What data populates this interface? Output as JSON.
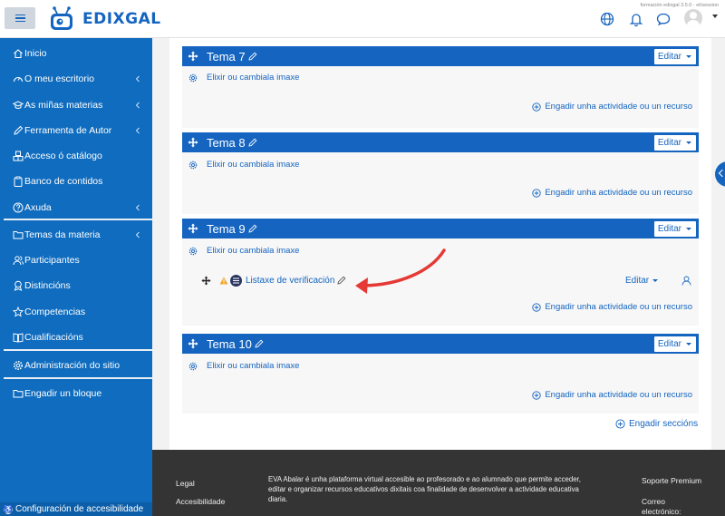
{
  "header": {
    "logo_text": "EDIXGAL",
    "version": "formación edixgal 3.5.0 - et/session",
    "icons": [
      "globe-icon",
      "bell-icon",
      "message-icon",
      "user-avatar"
    ]
  },
  "sidebar": {
    "items": [
      {
        "label": "Inicio",
        "icon": "home-icon",
        "expand": false
      },
      {
        "label": "O meu escritorio",
        "icon": "dashboard-icon",
        "expand": true
      },
      {
        "label": "As miñas materias",
        "icon": "graduation-cap-icon",
        "expand": true
      },
      {
        "label": "Ferramenta de Autor",
        "icon": "pencil-icon",
        "expand": true
      },
      {
        "label": "Acceso ó catálogo",
        "icon": "cubes-icon",
        "expand": false
      },
      {
        "label": "Banco de contidos",
        "icon": "clipboard-icon",
        "expand": false
      },
      {
        "label": "Axuda",
        "icon": "question-icon",
        "expand": true
      },
      {
        "label": "Temas da materia",
        "icon": "folder-icon",
        "expand": true
      },
      {
        "label": "Participantes",
        "icon": "users-icon",
        "expand": false
      },
      {
        "label": "Distincións",
        "icon": "badge-icon",
        "expand": false
      },
      {
        "label": "Competencias",
        "icon": "star-icon",
        "expand": false
      },
      {
        "label": "Cualificacións",
        "icon": "gradebook-icon",
        "expand": false
      },
      {
        "label": "Administración do sitio",
        "icon": "gear-icon",
        "expand": false
      },
      {
        "label": "Engadir un bloque",
        "icon": "folder-plus-icon",
        "expand": false
      }
    ],
    "accessibility": "Configuración de accesibilidade"
  },
  "sections": [
    {
      "title": "Tema 7",
      "edit": "Editar",
      "image_link": "Elixir ou cambiala imaxe",
      "add_link": "Engadir unha actividade ou un recurso"
    },
    {
      "title": "Tema 8",
      "edit": "Editar",
      "image_link": "Elixir ou cambiala imaxe",
      "add_link": "Engadir unha actividade ou un recurso"
    },
    {
      "title": "Tema 9",
      "edit": "Editar",
      "image_link": "Elixir ou cambiala imaxe",
      "add_link": "Engadir unha actividade ou un recurso",
      "activity": {
        "label": "Listaxe de verificación",
        "edit": "Editar"
      }
    },
    {
      "title": "Tema 10",
      "edit": "Editar",
      "image_link": "Elixir ou cambiala imaxe",
      "add_link": "Engadir unha actividade ou un recurso"
    }
  ],
  "add_sections": "Engadir seccións",
  "footer": {
    "legal": "Legal",
    "accessibility": "Accesibilidade",
    "description": "EVA Abalar é unha plataforma virtual accesible ao profesorado e ao alumnado que permite acceder, editar e organizar recursos educativos dixitais coa finalidade de desenvolver a actividade educativa diaria.",
    "support": "Soporte Premium",
    "email": "Correo electrónico:"
  },
  "colors": {
    "primary": "#1565c0",
    "sidebar": "#0f6cbf",
    "footer": "#343434",
    "arrow": "#e53935"
  }
}
